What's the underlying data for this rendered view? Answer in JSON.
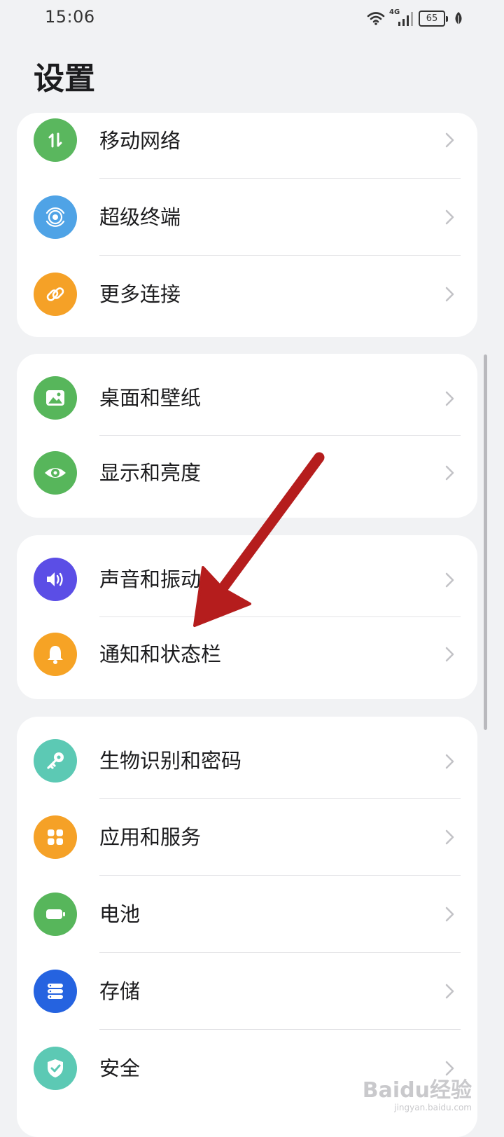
{
  "status_bar": {
    "time": "15:06",
    "network": "4G",
    "battery": "65",
    "icons": [
      "wifi-icon",
      "signal-icon",
      "battery-icon",
      "leaf-icon"
    ]
  },
  "page": {
    "title": "设置"
  },
  "groups": [
    {
      "items": [
        {
          "label": "移动网络",
          "icon": "mobile-network-icon",
          "color": "#5ab75e"
        },
        {
          "label": "超级终端",
          "icon": "super-device-icon",
          "color": "#4fa3e6"
        },
        {
          "label": "更多连接",
          "icon": "link-icon",
          "color": "#f5a127"
        }
      ]
    },
    {
      "items": [
        {
          "label": "桌面和壁纸",
          "icon": "wallpaper-icon",
          "color": "#57b65b"
        },
        {
          "label": "显示和亮度",
          "icon": "eye-icon",
          "color": "#57b65b"
        }
      ]
    },
    {
      "items": [
        {
          "label": "声音和振动",
          "icon": "sound-icon",
          "color": "#5b4ee6"
        },
        {
          "label": "通知和状态栏",
          "icon": "bell-icon",
          "color": "#f6a325"
        }
      ]
    },
    {
      "items": [
        {
          "label": "生物识别和密码",
          "icon": "key-icon",
          "color": "#5cc9b4"
        },
        {
          "label": "应用和服务",
          "icon": "apps-icon",
          "color": "#f5a127"
        },
        {
          "label": "电池",
          "icon": "battery-icon",
          "color": "#57b65b"
        },
        {
          "label": "存储",
          "icon": "storage-icon",
          "color": "#2563e0"
        },
        {
          "label": "安全",
          "icon": "shield-icon",
          "color": "#5cc9b4"
        }
      ]
    }
  ],
  "watermark": {
    "brand": "Baidu经验",
    "url": "jingyan.baidu.com"
  },
  "colors": {
    "background": "#f1f2f4",
    "card": "#ffffff",
    "annotation_arrow": "#b51d1d"
  }
}
